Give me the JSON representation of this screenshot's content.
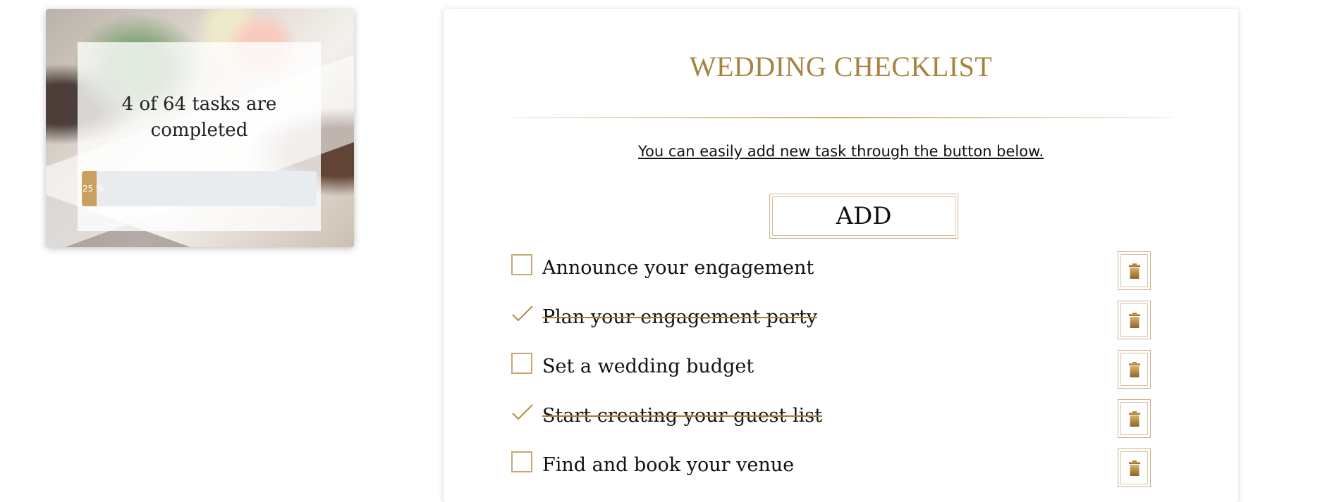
{
  "progress": {
    "completed_text": "4 of 64 tasks are completed",
    "percent_label": "6,25 %",
    "fraction": 0.0625
  },
  "checklist": {
    "title": "WEDDING CHECKLIST",
    "hint": "You can easily add new task through the button below.",
    "add_label": "ADD",
    "tasks": [
      {
        "label": "Announce your engagement",
        "done": false
      },
      {
        "label": "Plan your engagement party",
        "done": true
      },
      {
        "label": "Set a wedding budget",
        "done": false
      },
      {
        "label": "Start creating your guest list",
        "done": true
      },
      {
        "label": "Find and book your venue",
        "done": false
      }
    ]
  },
  "colors": {
    "accent": "#a8833f",
    "progress_fill": "#c9a060",
    "track": "#e9ecef"
  },
  "icons": {
    "checkbox": "checkbox-icon",
    "checkmark": "checkmark-icon",
    "delete": "trash-icon"
  }
}
